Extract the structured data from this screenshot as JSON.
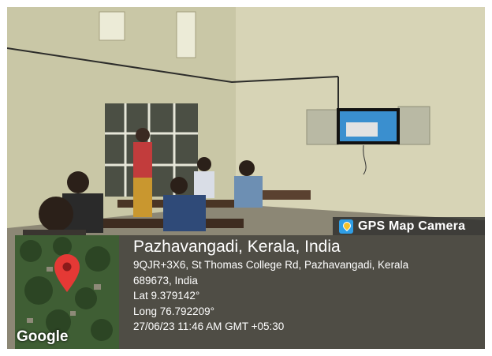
{
  "overlay": {
    "app_badge": "GPS Map Camera",
    "map_logo": "Google",
    "place": "Pazhavangadi, Kerala, India",
    "address_line1": "9QJR+3X6, St Thomas College Rd, Pazhavangadi, Kerala",
    "address_line2": "689673, India",
    "lat": "Lat 9.379142°",
    "long": "Long 76.792209°",
    "datetime": "27/06/23 11:46 AM GMT +05:30"
  },
  "icons": {
    "badge": "gps-map-camera-icon",
    "pin": "map-pin-icon"
  },
  "colors": {
    "pin": "#e53935",
    "wall": "#d8d5b4",
    "tv_screen": "#3a8fcf"
  }
}
